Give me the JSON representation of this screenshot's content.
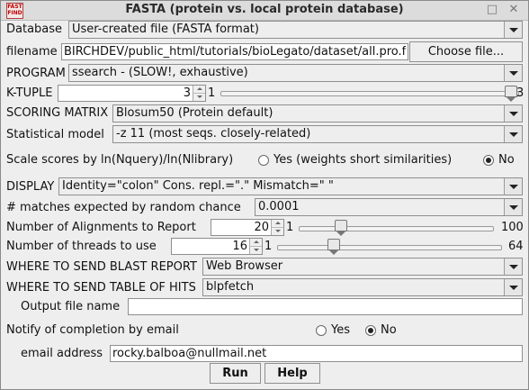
{
  "window": {
    "title": "FASTA (protein vs. local protein database)",
    "icon_text": "FAST FIND",
    "minimize_glyph": "□",
    "close_glyph": "✕"
  },
  "database": {
    "label": "Database",
    "value": "User-created file (FASTA format)"
  },
  "filename": {
    "label": "filename",
    "value": "BIRCHDEV/public_html/tutorials/bioLegato/dataset/all.pro.fsa\"",
    "button_label": "Choose file..."
  },
  "program": {
    "label": "PROGRAM",
    "value": "ssearch - (SLOW!, exhaustive)"
  },
  "ktuple": {
    "label": "K-TUPLE",
    "value": "3",
    "min": "1",
    "max": "3",
    "level": 1.0
  },
  "scoring_matrix": {
    "label": "SCORING MATRIX",
    "value": "Blosum50 (Protein default)"
  },
  "statistical_model": {
    "label": "Statistical model",
    "value": "-z 11 (most seqs. closely-related)"
  },
  "scale_scores": {
    "label": "Scale scores by ln(Nquery)/ln(Nlibrary)",
    "yes_label": "Yes (weights short similarities)",
    "no_label": "No",
    "selected": "No"
  },
  "display": {
    "label": "DISPLAY",
    "value": "Identity=\"colon\" Cons. repl.=\".\" Mismatch=\" \""
  },
  "expected_matches": {
    "label": "# matches expected by random chance",
    "value": "0.0001"
  },
  "num_alignments": {
    "label": "Number of Alignments to Report",
    "value": "20",
    "min": "1",
    "max": "100",
    "level": 0.2
  },
  "num_threads": {
    "label": "Number of threads to use",
    "value": "16",
    "min": "1",
    "max": "64",
    "level": 0.24
  },
  "blast_report": {
    "label": "WHERE TO SEND BLAST REPORT",
    "value": "Web Browser"
  },
  "table_of_hits": {
    "label": "WHERE TO SEND TABLE OF HITS",
    "value": "blpfetch"
  },
  "output_file": {
    "label": "Output file name",
    "value": ""
  },
  "notify": {
    "label": "Notify of completion by email",
    "yes_label": "Yes",
    "no_label": "No",
    "selected": "No"
  },
  "email": {
    "label": "email address",
    "value": "rocky.balboa@nullmail.net"
  },
  "buttons": {
    "run": "Run",
    "help": "Help"
  }
}
